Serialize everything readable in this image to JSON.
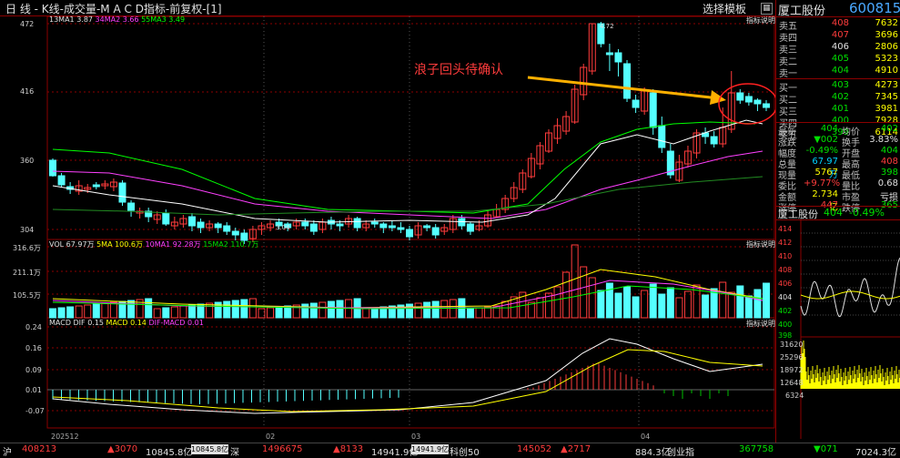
{
  "header": {
    "title": "日 线 - K线-成交量-M A C D指标-前复权-[1]",
    "select_template": "选择模板",
    "explain": "指标说明"
  },
  "ma_legend": {
    "ma1": "13MA1 3.87",
    "ma2": "34MA2 3.66",
    "ma3": "55MA3 3.49"
  },
  "vol_legend": {
    "vol": "VOL 67.97万",
    "ma5": "5MA 100.6万",
    "ma10": "10MA1 92.28万",
    "ma15": "15MA2 110.7万"
  },
  "macd_legend": {
    "dif": "MACD DIF 0.15",
    "macd": "MACD 0.14",
    "difmacd": "DIF-MACD 0.01"
  },
  "annotation": {
    "text": "浪子回头待确认",
    "high_label": "4.72",
    "low_label": "3.04"
  },
  "price_axis": [
    "472",
    "416",
    "360",
    "304"
  ],
  "vol_axis": [
    "316.6万",
    "211.1万",
    "105.5万"
  ],
  "macd_axis": [
    "0.24",
    "0.16",
    "0.09",
    "0.01",
    "-0.07"
  ],
  "date_axis": [
    "202512",
    "02",
    "03",
    "04"
  ],
  "colors": {
    "up": "#ff3c3c",
    "down": "#54ffff",
    "ma1": "#ffffff",
    "ma2": "#ff40ff",
    "ma3": "#00ff00",
    "arrow": "#ffb000",
    "grid": "#8b0000"
  },
  "stock": {
    "name": "厦工股份",
    "code": "600815",
    "mini_title": "厦工股份",
    "mini_price": "404",
    "mini_change": "-0.49%"
  },
  "orderbook": {
    "asks": [
      {
        "label": "卖五",
        "price": "408",
        "vol": "7632"
      },
      {
        "label": "卖四",
        "price": "407",
        "vol": "3696"
      },
      {
        "label": "卖三",
        "price": "406",
        "vol": "2806"
      },
      {
        "label": "卖二",
        "price": "405",
        "vol": "5323"
      },
      {
        "label": "卖一",
        "price": "404",
        "vol": "4910"
      }
    ],
    "bids": [
      {
        "label": "买一",
        "price": "403",
        "vol": "4273"
      },
      {
        "label": "买二",
        "price": "402",
        "vol": "7345"
      },
      {
        "label": "买三",
        "price": "401",
        "vol": "3981"
      },
      {
        "label": "买四",
        "price": "400",
        "vol": "7928"
      },
      {
        "label": "买五",
        "price": "399",
        "vol": "6114"
      }
    ]
  },
  "quote": [
    {
      "l1": "最新",
      "v1": "404",
      "l2": "均价",
      "v2": "402"
    },
    {
      "l1": "涨跌",
      "v1": "▼002",
      "l2": "换手",
      "v2": "3.83%"
    },
    {
      "l1": "幅度",
      "v1": "-0.49%",
      "l2": "开盘",
      "v2": "404"
    },
    {
      "l1": "总量",
      "v1": "67.97万",
      "l2": "最高",
      "v2": "408"
    },
    {
      "l1": "现量",
      "v1": "5767",
      "l2": "最低",
      "v2": "398"
    },
    {
      "l1": "委比",
      "v1": "+9.77%",
      "l2": "量比",
      "v2": "0.68"
    },
    {
      "l1": "金额",
      "v1": "2.734亿",
      "l2": "市盈",
      "v2": "亏损"
    },
    {
      "l1": "涨停",
      "v1": "447",
      "l2": "跌停",
      "v2": "365"
    }
  ],
  "mini_axis": [
    "414",
    "412",
    "410",
    "408",
    "406",
    "404",
    "402",
    "400",
    "398"
  ],
  "mini_vol_axis": [
    "31620",
    "25296",
    "18972",
    "12648",
    "6324"
  ],
  "bottom": {
    "i1": "沪",
    "i1v": "408213",
    "i1c": "▲3070",
    "i1a": "10845.8亿",
    "i1b": "10845.8亿",
    "i2": "深",
    "i2v": "1496675",
    "i2c": "▲8133",
    "i2a": "14941.9亿",
    "i2b": "14941.9亿",
    "i3": "科创50",
    "i3v": "145052",
    "i3c": "▲2717",
    "i3a": "884.3亿",
    "i4": "创业指",
    "i4v": "367758",
    "i4c": "▼071",
    "i4a": "7024.3亿"
  }
}
